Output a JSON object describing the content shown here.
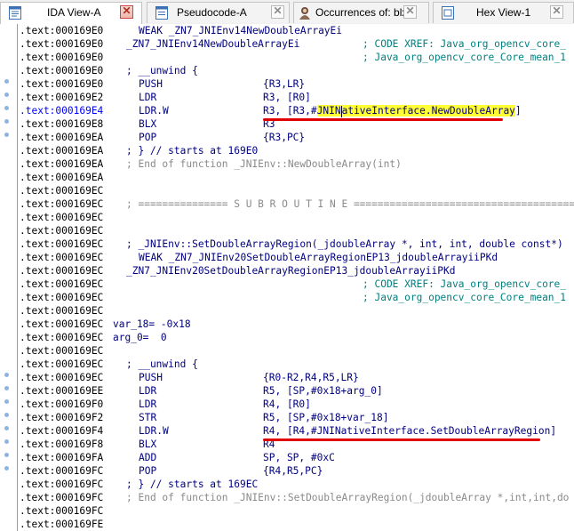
{
  "tabs": [
    {
      "label": "IDA View-A",
      "icon": "text-view-icon",
      "close_style": "red",
      "active": true
    },
    {
      "label": "Pseudocode-A",
      "icon": "pseudocode-icon",
      "close_style": "gray",
      "active": false
    },
    {
      "label": "Occurrences of: blx",
      "icon": "search-results-icon",
      "close_style": "gray",
      "active": false
    },
    {
      "label": "Hex View-1",
      "icon": "hex-view-icon",
      "close_style": "gray",
      "active": false
    }
  ],
  "close_glyph": "✕",
  "listing": {
    "rows": [
      {
        "addr": ".text:000169E0",
        "label": "WEAK _ZN7_JNIEnv14NewDoubleArrayEi"
      },
      {
        "addr": ".text:000169E0",
        "name": "_ZN7_JNIEnv14NewDoubleArrayEi",
        "xref": "; CODE XREF: Java_org_opencv_core_"
      },
      {
        "addr": ".text:000169E0",
        "xref": "; Java_org_opencv_core_Core_mean_1"
      },
      {
        "addr": ".text:000169E0",
        "comment": "; __unwind {"
      },
      {
        "addr": ".text:000169E0",
        "mnem": "PUSH",
        "ops": "{R3,LR}"
      },
      {
        "addr": ".text:000169E2",
        "mnem": "LDR",
        "ops": "R3, [R0]"
      },
      {
        "addr": ".text:000169E4",
        "mnem": "LDR.W",
        "ops_pre": "R3, ",
        "ops_box": "[R3,#JNINativeInterface.NewDoubleArray]",
        "highlight": "JNINativeInterface.NewDoubleArray"
      },
      {
        "addr": ".text:000169E8",
        "mnem": "BLX",
        "ops": "R3"
      },
      {
        "addr": ".text:000169EA",
        "mnem": "POP",
        "ops": "{R3,PC}"
      },
      {
        "addr": ".text:000169EA",
        "comment": "; } // starts at 169E0"
      },
      {
        "addr": ".text:000169EA",
        "comment": "; End of function _JNIEnv::NewDoubleArray(int)"
      },
      {
        "addr": ".text:000169EA"
      },
      {
        "addr": ".text:000169EC"
      },
      {
        "addr": ".text:000169EC",
        "comment": "; =============== S U B R O U T I N E ======================================="
      },
      {
        "addr": ".text:000169EC"
      },
      {
        "addr": ".text:000169EC"
      },
      {
        "addr": ".text:000169EC",
        "comment": "; _JNIEnv::SetDoubleArrayRegion(_jdoubleArray *, int, int, double const*)"
      },
      {
        "addr": ".text:000169EC",
        "label": "WEAK _ZN7_JNIEnv20SetDoubleArrayRegionEP13_jdoubleArrayiiPKd"
      },
      {
        "addr": ".text:000169EC",
        "name": "_ZN7_JNIEnv20SetDoubleArrayRegionEP13_jdoubleArrayiiPKd"
      },
      {
        "addr": ".text:000169EC",
        "xref": "; CODE XREF: Java_org_opencv_core_"
      },
      {
        "addr": ".text:000169EC",
        "xref": "; Java_org_opencv_core_Core_mean_1"
      },
      {
        "addr": ".text:000169EC"
      },
      {
        "addr": ".text:000169EC",
        "var": "var_18= -0x18"
      },
      {
        "addr": ".text:000169EC",
        "var": "arg_0=  0"
      },
      {
        "addr": ".text:000169EC"
      },
      {
        "addr": ".text:000169EC",
        "comment": "; __unwind {"
      },
      {
        "addr": ".text:000169EC",
        "mnem": "PUSH",
        "ops": "{R0-R2,R4,R5,LR}"
      },
      {
        "addr": ".text:000169EE",
        "mnem": "LDR",
        "ops": "R5, [SP,#0x18+arg_0]"
      },
      {
        "addr": ".text:000169F0",
        "mnem": "LDR",
        "ops": "R4, [R0]"
      },
      {
        "addr": ".text:000169F2",
        "mnem": "STR",
        "ops": "R5, [SP,#0x18+var_18]"
      },
      {
        "addr": ".text:000169F4",
        "mnem": "LDR.W",
        "ops_pre": "R4, ",
        "ops_box": "[R4,#JNINativeInterface.SetDoubleArrayRegion]"
      },
      {
        "addr": ".text:000169F8",
        "mnem": "BLX",
        "ops": "R4"
      },
      {
        "addr": ".text:000169FA",
        "mnem": "ADD",
        "ops": "SP, SP, #0xC"
      },
      {
        "addr": ".text:000169FC",
        "mnem": "POP",
        "ops": "{R4,R5,PC}"
      },
      {
        "addr": ".text:000169FC",
        "comment": "; } // starts at 169EC"
      },
      {
        "addr": ".text:000169FC",
        "comment": "; End of function _JNIEnv::SetDoubleArrayRegion(_jdoubleArray *,int,int,do"
      },
      {
        "addr": ".text:000169FC"
      },
      {
        "addr": ".text:000169FE"
      },
      {
        "addr": ".text:000169FE"
      }
    ]
  },
  "colors": {
    "address": "#000000",
    "current_address": "#0000ff",
    "instruction": "#000080",
    "comment": "#8a8a8a",
    "xref": "#008080",
    "highlight": "#ffff33",
    "underline_annotation": "#e00000",
    "gutter_dot": "#8db4e0"
  }
}
